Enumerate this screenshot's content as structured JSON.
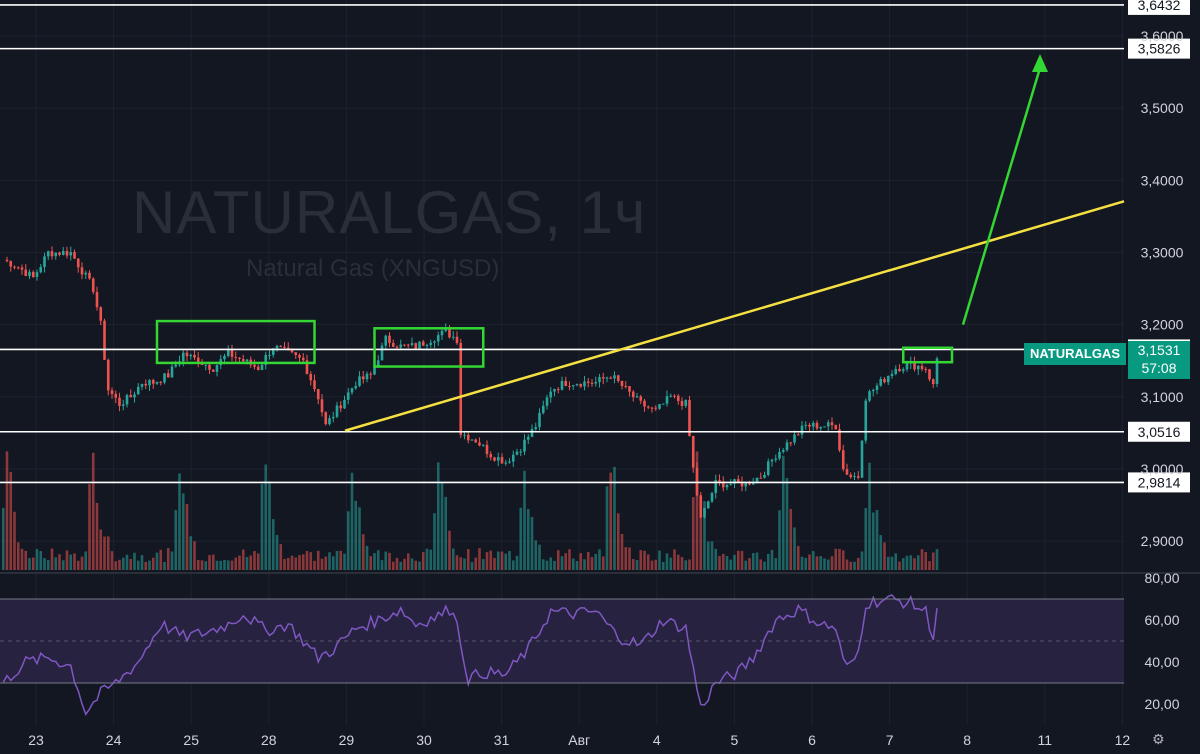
{
  "watermark": {
    "title": "NATURALGAS, 1ч",
    "subtitle": "Natural Gas (XNGUSD)"
  },
  "symbol_tag": "NATURALGAS",
  "last_price": {
    "value": "3,1531",
    "countdown": "57:08"
  },
  "colors": {
    "background": "#131722",
    "up": "#26a69a",
    "down": "#ef5350",
    "rsi_line": "#7e57c2",
    "rsi_band": "#2a2344",
    "trendline": "#f5e042",
    "box": "#34d634",
    "arrow": "#34d634",
    "level_line": "#ffffff",
    "axis_text": "#d1d4dc"
  },
  "icons": {
    "settings": "gear-icon"
  },
  "chart_data": {
    "type": "candlestick",
    "timeframe": "1ч",
    "price_axis": {
      "ticks": [
        "3,6000",
        "3,5000",
        "3,4000",
        "3,3000",
        "3,2000",
        "3,1000",
        "3,0000",
        "2,9000"
      ],
      "tick_values": [
        3.6,
        3.5,
        3.4,
        3.3,
        3.2,
        3.1,
        3.0,
        2.9
      ],
      "range": [
        2.86,
        3.65
      ]
    },
    "time_axis": {
      "labels": [
        "23",
        "24",
        "25",
        "28",
        "29",
        "30",
        "31",
        "Авг",
        "4",
        "5",
        "6",
        "7",
        "8",
        "11",
        "12"
      ]
    },
    "levels": [
      {
        "value": 3.6432,
        "label": "3,6432"
      },
      {
        "value": 3.5826,
        "label": "3,5826"
      },
      {
        "value": 3.1657,
        "label": "3,1657"
      },
      {
        "value": 3.0516,
        "label": "3,0516"
      },
      {
        "value": 2.9814,
        "label": "2,9814"
      }
    ],
    "price_keypoints": [
      [
        0,
        3.29
      ],
      [
        4,
        3.28
      ],
      [
        8,
        3.265
      ],
      [
        12,
        3.3
      ],
      [
        18,
        3.3
      ],
      [
        24,
        3.25
      ],
      [
        26,
        3.2
      ],
      [
        28,
        3.11
      ],
      [
        31,
        3.09
      ],
      [
        34,
        3.1
      ],
      [
        37,
        3.12
      ],
      [
        40,
        3.12
      ],
      [
        44,
        3.13
      ],
      [
        48,
        3.16
      ],
      [
        52,
        3.15
      ],
      [
        56,
        3.14
      ],
      [
        60,
        3.16
      ],
      [
        64,
        3.15
      ],
      [
        68,
        3.14
      ],
      [
        72,
        3.17
      ],
      [
        76,
        3.16
      ],
      [
        80,
        3.15
      ],
      [
        84,
        3.1
      ],
      [
        86,
        3.06
      ],
      [
        90,
        3.09
      ],
      [
        94,
        3.12
      ],
      [
        98,
        3.13
      ],
      [
        102,
        3.18
      ],
      [
        106,
        3.17
      ],
      [
        110,
        3.17
      ],
      [
        114,
        3.18
      ],
      [
        118,
        3.19
      ],
      [
        121,
        3.18
      ],
      [
        122,
        3.05
      ],
      [
        126,
        3.04
      ],
      [
        130,
        3.02
      ],
      [
        134,
        3.01
      ],
      [
        138,
        3.03
      ],
      [
        142,
        3.06
      ],
      [
        146,
        3.11
      ],
      [
        150,
        3.12
      ],
      [
        154,
        3.12
      ],
      [
        158,
        3.12
      ],
      [
        162,
        3.13
      ],
      [
        166,
        3.11
      ],
      [
        170,
        3.09
      ],
      [
        174,
        3.08
      ],
      [
        178,
        3.1
      ],
      [
        182,
        3.09
      ],
      [
        184,
        3.0
      ],
      [
        186,
        2.93
      ],
      [
        190,
        2.98
      ],
      [
        194,
        2.98
      ],
      [
        198,
        2.98
      ],
      [
        202,
        2.99
      ],
      [
        206,
        3.02
      ],
      [
        210,
        3.04
      ],
      [
        214,
        3.06
      ],
      [
        218,
        3.06
      ],
      [
        222,
        3.06
      ],
      [
        224,
        3.0
      ],
      [
        226,
        2.99
      ],
      [
        228,
        2.99
      ],
      [
        230,
        3.1
      ],
      [
        234,
        3.12
      ],
      [
        238,
        3.14
      ],
      [
        242,
        3.145
      ],
      [
        246,
        3.14
      ],
      [
        248,
        3.115
      ],
      [
        249,
        3.1531
      ]
    ],
    "rsi": {
      "ticks": [
        "80,00",
        "60,00",
        "40,00",
        "20,00"
      ],
      "tick_values": [
        80,
        60,
        40,
        20
      ],
      "band": [
        30,
        70
      ],
      "range": [
        10,
        80
      ],
      "keypoints": [
        [
          0,
          30
        ],
        [
          6,
          40
        ],
        [
          12,
          42
        ],
        [
          18,
          38
        ],
        [
          22,
          16
        ],
        [
          26,
          25
        ],
        [
          30,
          30
        ],
        [
          36,
          40
        ],
        [
          42,
          58
        ],
        [
          48,
          52
        ],
        [
          54,
          54
        ],
        [
          60,
          58
        ],
        [
          64,
          63
        ],
        [
          70,
          55
        ],
        [
          76,
          58
        ],
        [
          84,
          42
        ],
        [
          88,
          46
        ],
        [
          94,
          56
        ],
        [
          100,
          60
        ],
        [
          106,
          65
        ],
        [
          110,
          58
        ],
        [
          116,
          62
        ],
        [
          120,
          66
        ],
        [
          124,
          32
        ],
        [
          128,
          35
        ],
        [
          134,
          34
        ],
        [
          140,
          46
        ],
        [
          146,
          64
        ],
        [
          152,
          63
        ],
        [
          158,
          64
        ],
        [
          164,
          52
        ],
        [
          170,
          48
        ],
        [
          176,
          60
        ],
        [
          182,
          56
        ],
        [
          186,
          18
        ],
        [
          190,
          30
        ],
        [
          196,
          35
        ],
        [
          200,
          42
        ],
        [
          206,
          60
        ],
        [
          212,
          65
        ],
        [
          218,
          58
        ],
        [
          222,
          56
        ],
        [
          224,
          40
        ],
        [
          226,
          38
        ],
        [
          228,
          45
        ],
        [
          230,
          68
        ],
        [
          236,
          70
        ],
        [
          242,
          68
        ],
        [
          246,
          64
        ],
        [
          248,
          52
        ],
        [
          249,
          66
        ]
      ]
    }
  }
}
